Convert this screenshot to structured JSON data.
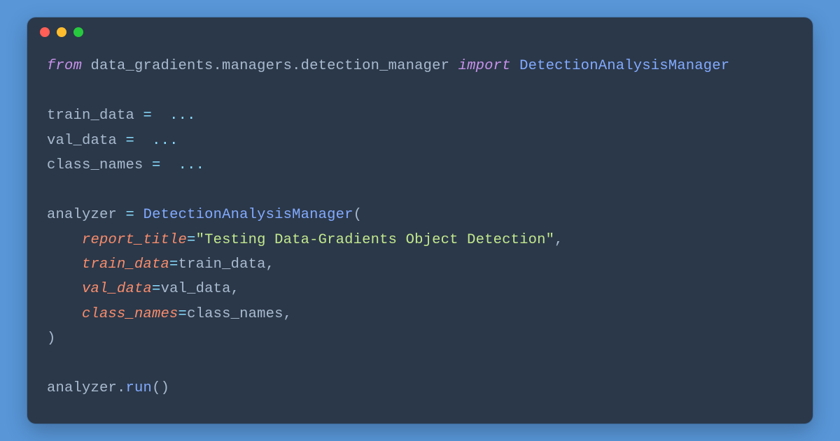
{
  "code": {
    "line1": {
      "from": "from",
      "module": "data_gradients.managers.detection_manager",
      "import": "import",
      "cls": "DetectionAnalysisManager"
    },
    "line2": "",
    "line3": {
      "var": "train_data",
      "op": "=",
      "val": "..."
    },
    "line4": {
      "var": "val_data",
      "op": "=",
      "val": "..."
    },
    "line5": {
      "var": "class_names",
      "op": "=",
      "val": "..."
    },
    "line6": "",
    "line7": {
      "var": "analyzer",
      "op": "=",
      "cls": "DetectionAnalysisManager",
      "paren": "("
    },
    "line8": {
      "param": "report_title",
      "op": "=",
      "str": "\"Testing Data-Gradients Object Detection\"",
      "comma": ","
    },
    "line9": {
      "param": "train_data",
      "op": "=",
      "val": "train_data",
      "comma": ","
    },
    "line10": {
      "param": "val_data",
      "op": "=",
      "val": "val_data",
      "comma": ","
    },
    "line11": {
      "param": "class_names",
      "op": "=",
      "val": "class_names",
      "comma": ","
    },
    "line12": {
      "paren": ")"
    },
    "line13": "",
    "line14": {
      "var": "analyzer",
      "dot": ".",
      "fn": "run",
      "parens": "()"
    }
  }
}
